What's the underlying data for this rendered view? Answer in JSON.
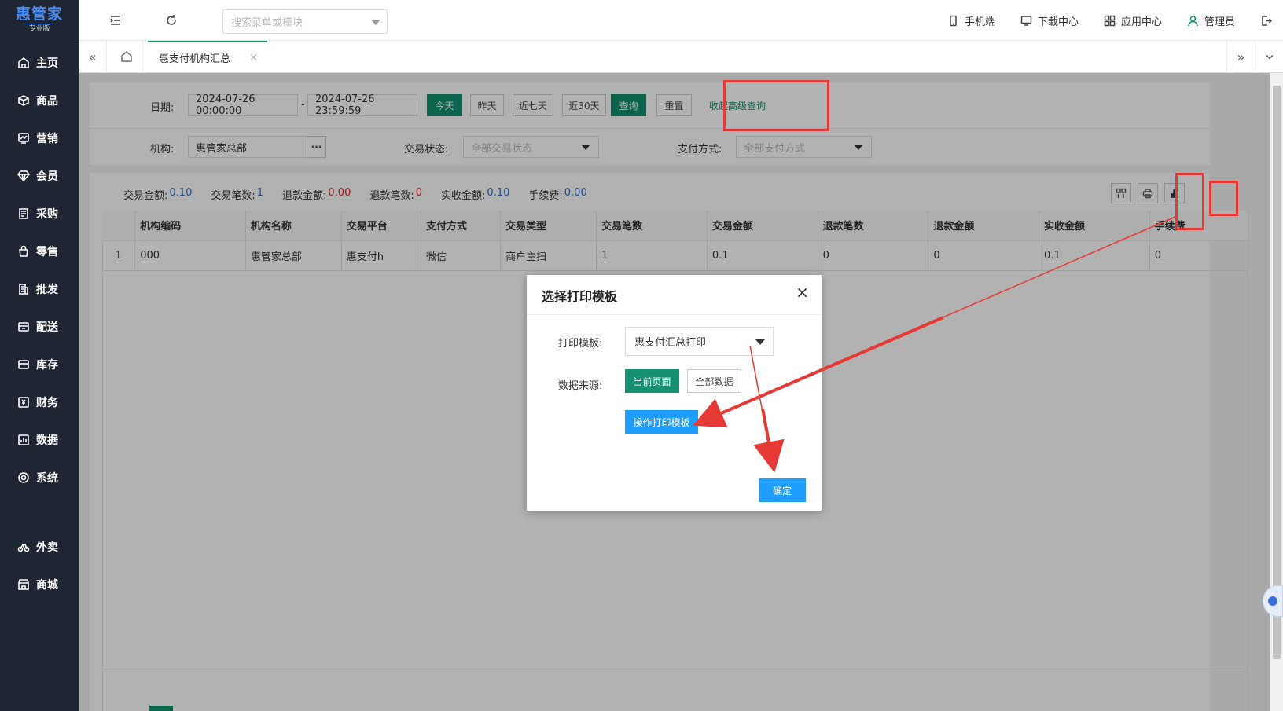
{
  "logo": {
    "name": "惠管家",
    "edition": "专业版"
  },
  "sidebar": {
    "items": [
      {
        "label": "主页",
        "icon": "home-icon"
      },
      {
        "label": "商品",
        "icon": "box-icon"
      },
      {
        "label": "营销",
        "icon": "chart-line-icon"
      },
      {
        "label": "会员",
        "icon": "diamond-icon"
      },
      {
        "label": "采购",
        "icon": "list-icon"
      },
      {
        "label": "零售",
        "icon": "bag-icon"
      },
      {
        "label": "批发",
        "icon": "building-icon"
      },
      {
        "label": "配送",
        "icon": "delivery-icon"
      },
      {
        "label": "库存",
        "icon": "warehouse-icon"
      },
      {
        "label": "财务",
        "icon": "money-icon"
      },
      {
        "label": "数据",
        "icon": "bar-chart-icon"
      },
      {
        "label": "系统",
        "icon": "settings-icon"
      }
    ],
    "extra_items": [
      {
        "label": "外卖",
        "icon": "bike-icon"
      },
      {
        "label": "商城",
        "icon": "store-icon"
      }
    ]
  },
  "topbar": {
    "search_placeholder": "搜索菜单或模块",
    "right_items": [
      {
        "label": "手机端",
        "icon": "mobile-icon"
      },
      {
        "label": "下载中心",
        "icon": "monitor-icon"
      },
      {
        "label": "应用中心",
        "icon": "apps-icon"
      },
      {
        "label": "管理员",
        "icon": "user-icon"
      }
    ]
  },
  "tabs": {
    "active": "惠支付机构汇总",
    "close": "×"
  },
  "filters": {
    "date_label": "日期:",
    "date_start": "2024-07-26 00:00:00",
    "date_sep": "-",
    "date_end": "2024-07-26 23:59:59",
    "quick": [
      "今天",
      "昨天",
      "近七天",
      "近30天"
    ],
    "query": "查询",
    "reset": "重置",
    "collapse": "收起高级查询",
    "org_label": "机构:",
    "org_value": "惠管家总部",
    "org_more": "···",
    "status_label": "交易状态:",
    "status_placeholder": "全部交易状态",
    "paymethod_label": "支付方式:",
    "paymethod_placeholder": "全部支付方式"
  },
  "summary": [
    {
      "key": "交易金额:",
      "value": "0.10",
      "color": "#2f6bbf"
    },
    {
      "key": "交易笔数:",
      "value": "1",
      "color": "#2f6bbf"
    },
    {
      "key": "退款金额:",
      "value": "0.00",
      "color": "#e02020"
    },
    {
      "key": "退款笔数:",
      "value": "0",
      "color": "#e02020"
    },
    {
      "key": "实收金额:",
      "value": "0.10",
      "color": "#2f6bbf"
    },
    {
      "key": "手续费:",
      "value": "0.00",
      "color": "#2f6bbf"
    }
  ],
  "table": {
    "columns": [
      "",
      "机构编码",
      "机构名称",
      "交易平台",
      "支付方式",
      "交易类型",
      "交易笔数",
      "交易金额",
      "退款笔数",
      "退款金额",
      "实收金额",
      "手续费"
    ],
    "rows": [
      [
        "1",
        "000",
        "惠管家总部",
        "惠支付h",
        "微信",
        "商户主扫",
        "1",
        "0.1",
        "0",
        "0",
        "0.1",
        "0"
      ]
    ]
  },
  "modal": {
    "title": "选择打印模板",
    "close": "×",
    "template_label": "打印模板:",
    "template_value": "惠支付汇总打印",
    "source_label": "数据来源:",
    "source_current": "当前页面",
    "source_all": "全部数据",
    "operate_button": "操作打印模板",
    "confirm": "确定"
  },
  "colors": {
    "sidebar_bg": "#1f2633",
    "primary": "#13906f",
    "modal_blue": "#1e9fff",
    "annotation_red": "#e53935"
  }
}
